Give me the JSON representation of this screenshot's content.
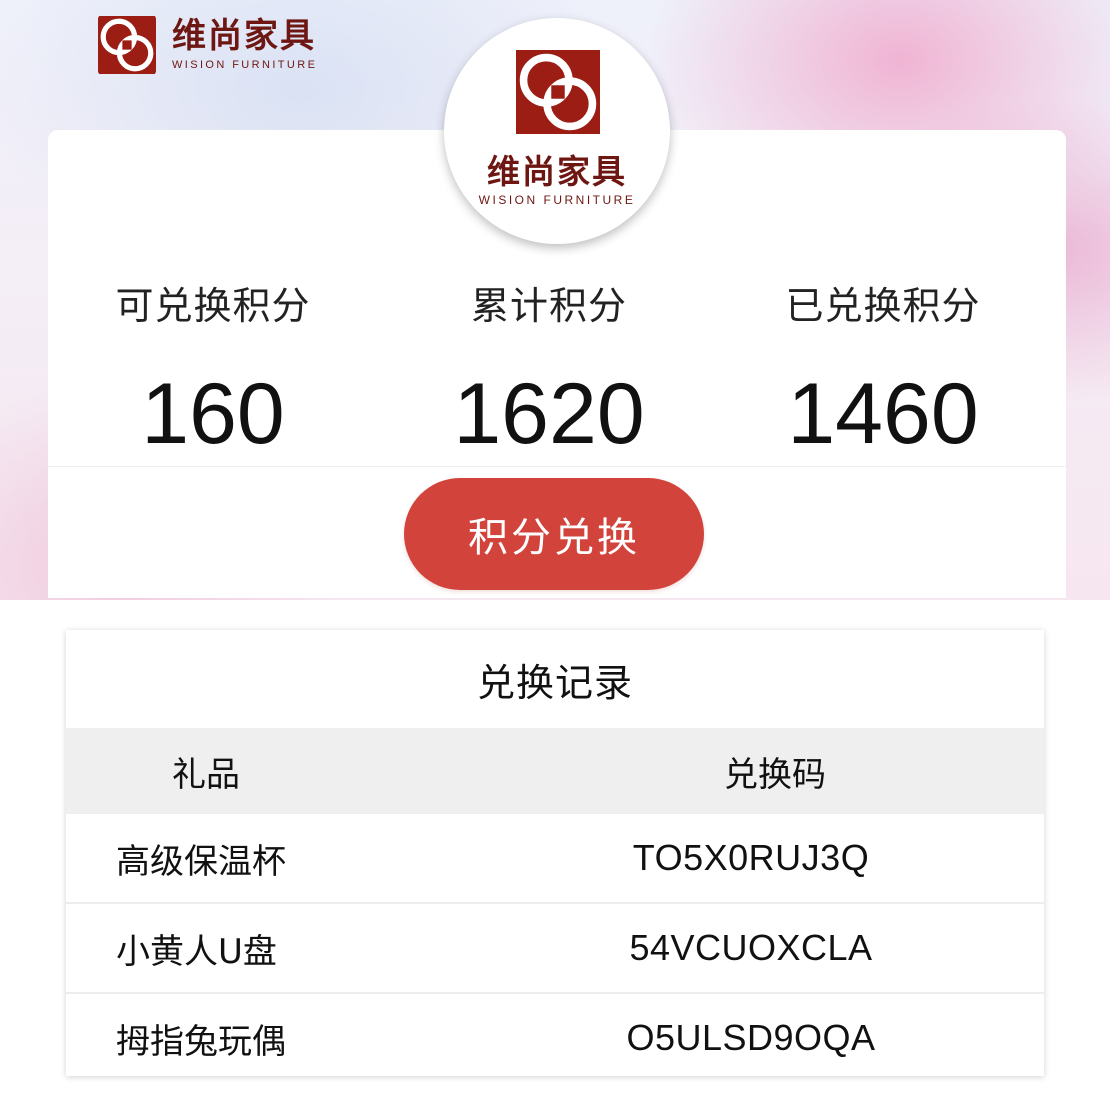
{
  "brand": {
    "name_cn": "维尚家具",
    "name_en": "WISION FURNITURE",
    "color": "#6e1712",
    "logo_mark_color": "#9b1d14"
  },
  "points": {
    "available_label": "可兑换积分",
    "available_value": "160",
    "total_label": "累计积分",
    "total_value": "1620",
    "redeemed_label": "已兑换积分",
    "redeemed_value": "1460"
  },
  "actions": {
    "redeem_label": "积分兑换",
    "redeem_color": "#d2433c"
  },
  "records": {
    "title": "兑换记录",
    "columns": {
      "gift": "礼品",
      "code": "兑换码"
    },
    "rows": [
      {
        "gift": "高级保温杯",
        "code": "TO5X0RUJ3Q"
      },
      {
        "gift": "小黄人U盘",
        "code": "54VCUOXCLA"
      },
      {
        "gift": "拇指兔玩偶",
        "code": "O5ULSD9OQA"
      }
    ]
  }
}
